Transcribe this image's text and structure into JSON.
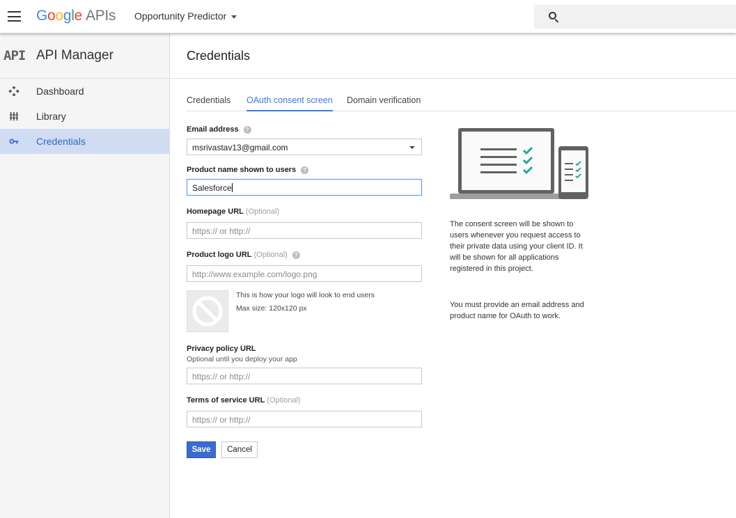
{
  "header": {
    "brand_google": [
      "G",
      "o",
      "o",
      "g",
      "l",
      "e"
    ],
    "brand_apis": "APIs",
    "project": "Opportunity Predictor",
    "search_placeholder": ""
  },
  "sidebar": {
    "badge": "API",
    "title": "API Manager",
    "items": [
      {
        "label": "Dashboard",
        "icon": "dashboard-icon",
        "active": false
      },
      {
        "label": "Library",
        "icon": "library-icon",
        "active": false
      },
      {
        "label": "Credentials",
        "icon": "key-icon",
        "active": true
      }
    ]
  },
  "main": {
    "title": "Credentials",
    "tabs": [
      {
        "label": "Credentials",
        "active": false
      },
      {
        "label": "OAuth consent screen",
        "active": true
      },
      {
        "label": "Domain verification",
        "active": false
      }
    ],
    "form": {
      "email": {
        "label": "Email address",
        "value": "msrivastav13@gmail.com"
      },
      "product": {
        "label": "Product name shown to users",
        "value": "Salesforce"
      },
      "homepage": {
        "label": "Homepage URL",
        "optional": "(Optional)",
        "placeholder": "https:// or http://"
      },
      "logo": {
        "label": "Product logo URL",
        "optional": "(Optional)",
        "placeholder": "http://www.example.com/logo.png",
        "note1": "This is how your logo will look to end users",
        "note2": "Max size: 120x120 px"
      },
      "privacy": {
        "label": "Privacy policy URL",
        "sub": "Optional until you deploy your app",
        "placeholder": "https:// or http://"
      },
      "tos": {
        "label": "Terms of service URL",
        "optional": "(Optional)",
        "placeholder": "https:// or http://"
      },
      "save": "Save",
      "cancel": "Cancel"
    },
    "info": {
      "p1": "The consent screen will be shown to users whenever you request access to their private data using your client ID. It will be shown for all applications registered in this project.",
      "p2": "You must provide an email address and product name for OAuth to work."
    }
  },
  "colors": {
    "accent": "#3b78e7",
    "active_nav_bg": "#cfdcf2",
    "save_button": "#3b6bce",
    "check_green": "#26a69a"
  }
}
